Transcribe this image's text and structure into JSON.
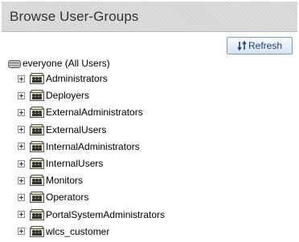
{
  "header": {
    "title": "Browse User-Groups"
  },
  "toolbar": {
    "refresh_label": "Refresh"
  },
  "tree": {
    "root_label": "everyone (All Users)",
    "groups": [
      "Administrators",
      "Deployers",
      "ExternalAdministrators",
      "ExternalUsers",
      "InternalAdministrators",
      "InternalUsers",
      "Monitors",
      "Operators",
      "PortalSystemAdministrators",
      "wlcs_customer"
    ]
  },
  "icons": {
    "root": "server-icon",
    "group": "user-group-icon",
    "expander": "plus-expander-icon",
    "refresh": "refresh-icon"
  }
}
